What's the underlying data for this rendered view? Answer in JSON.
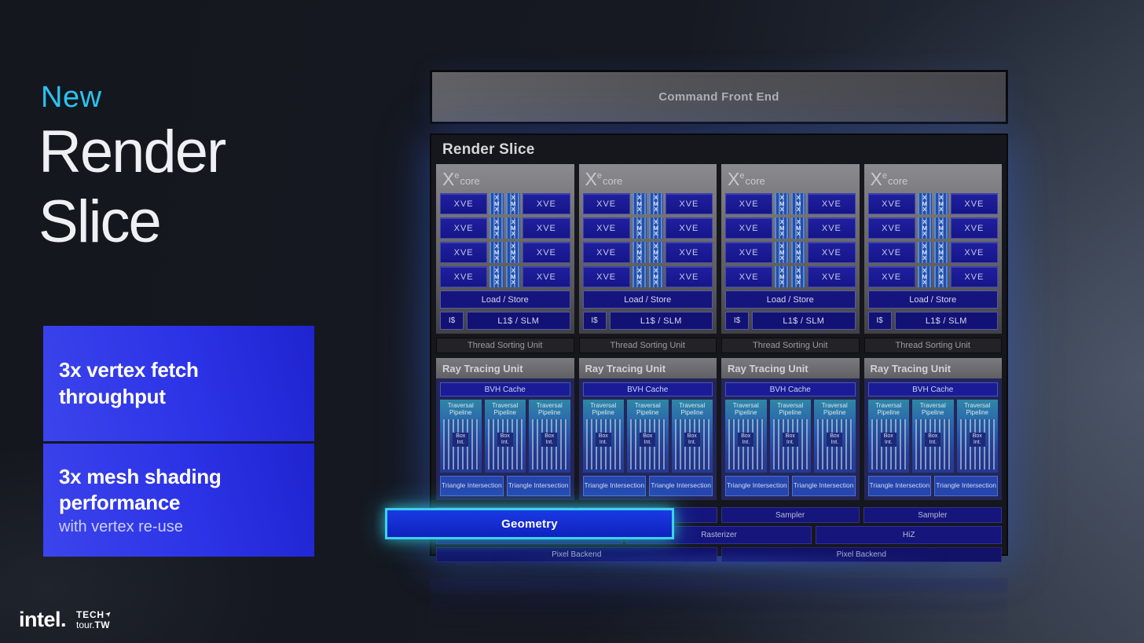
{
  "left": {
    "eyebrow": "New",
    "title_lines": [
      "Render",
      "Slice"
    ],
    "cards": [
      {
        "title": "3x vertex fetch throughput",
        "subtitle": ""
      },
      {
        "title": "3x mesh shading performance",
        "subtitle": "with vertex re-use"
      }
    ]
  },
  "footer": {
    "intel": "intel.",
    "tech": "TECH",
    "tour": "tour.",
    "tw": "TW"
  },
  "diagram": {
    "command_front_end": "Command Front End",
    "panel_title": "Render Slice",
    "core": {
      "brand_x": "X",
      "brand_sup": "e",
      "brand_core": "core",
      "xve": "XVE",
      "xmx": [
        "X",
        "M",
        "X"
      ],
      "load_store": "Load / Store",
      "icache": "I$",
      "l1_slm": "L1$ / SLM",
      "thread_sorting_unit": "Thread Sorting Unit"
    },
    "rtu": {
      "title": "Ray Tracing Unit",
      "bvh_cache": "BVH Cache",
      "traversal_pipeline": "Traversal Pipeline",
      "box_int": "Box Int.",
      "triangle_intersection": "Triangle Intersection"
    },
    "bottom": {
      "sampler": "Sampler",
      "geometry": "Geometry",
      "rasterizer": "Rasterizer",
      "hiz": "HiZ",
      "pixel_backend": "Pixel Backend"
    },
    "counts": {
      "cores": 4,
      "eu_rows": 4,
      "pipes_per_rtu": 3,
      "tris_per_rtu": 2,
      "samplers": 4,
      "pixel_backends": 2
    }
  },
  "colors": {
    "accent_cyan": "#2ac3f2",
    "card_blue_start": "#3c44ec",
    "card_blue_end": "#1f24cf",
    "highlight_border": "#3bd2ee",
    "navy_box": "#15157c",
    "background_dark": "#14171d",
    "background_slate": "#343b48"
  }
}
